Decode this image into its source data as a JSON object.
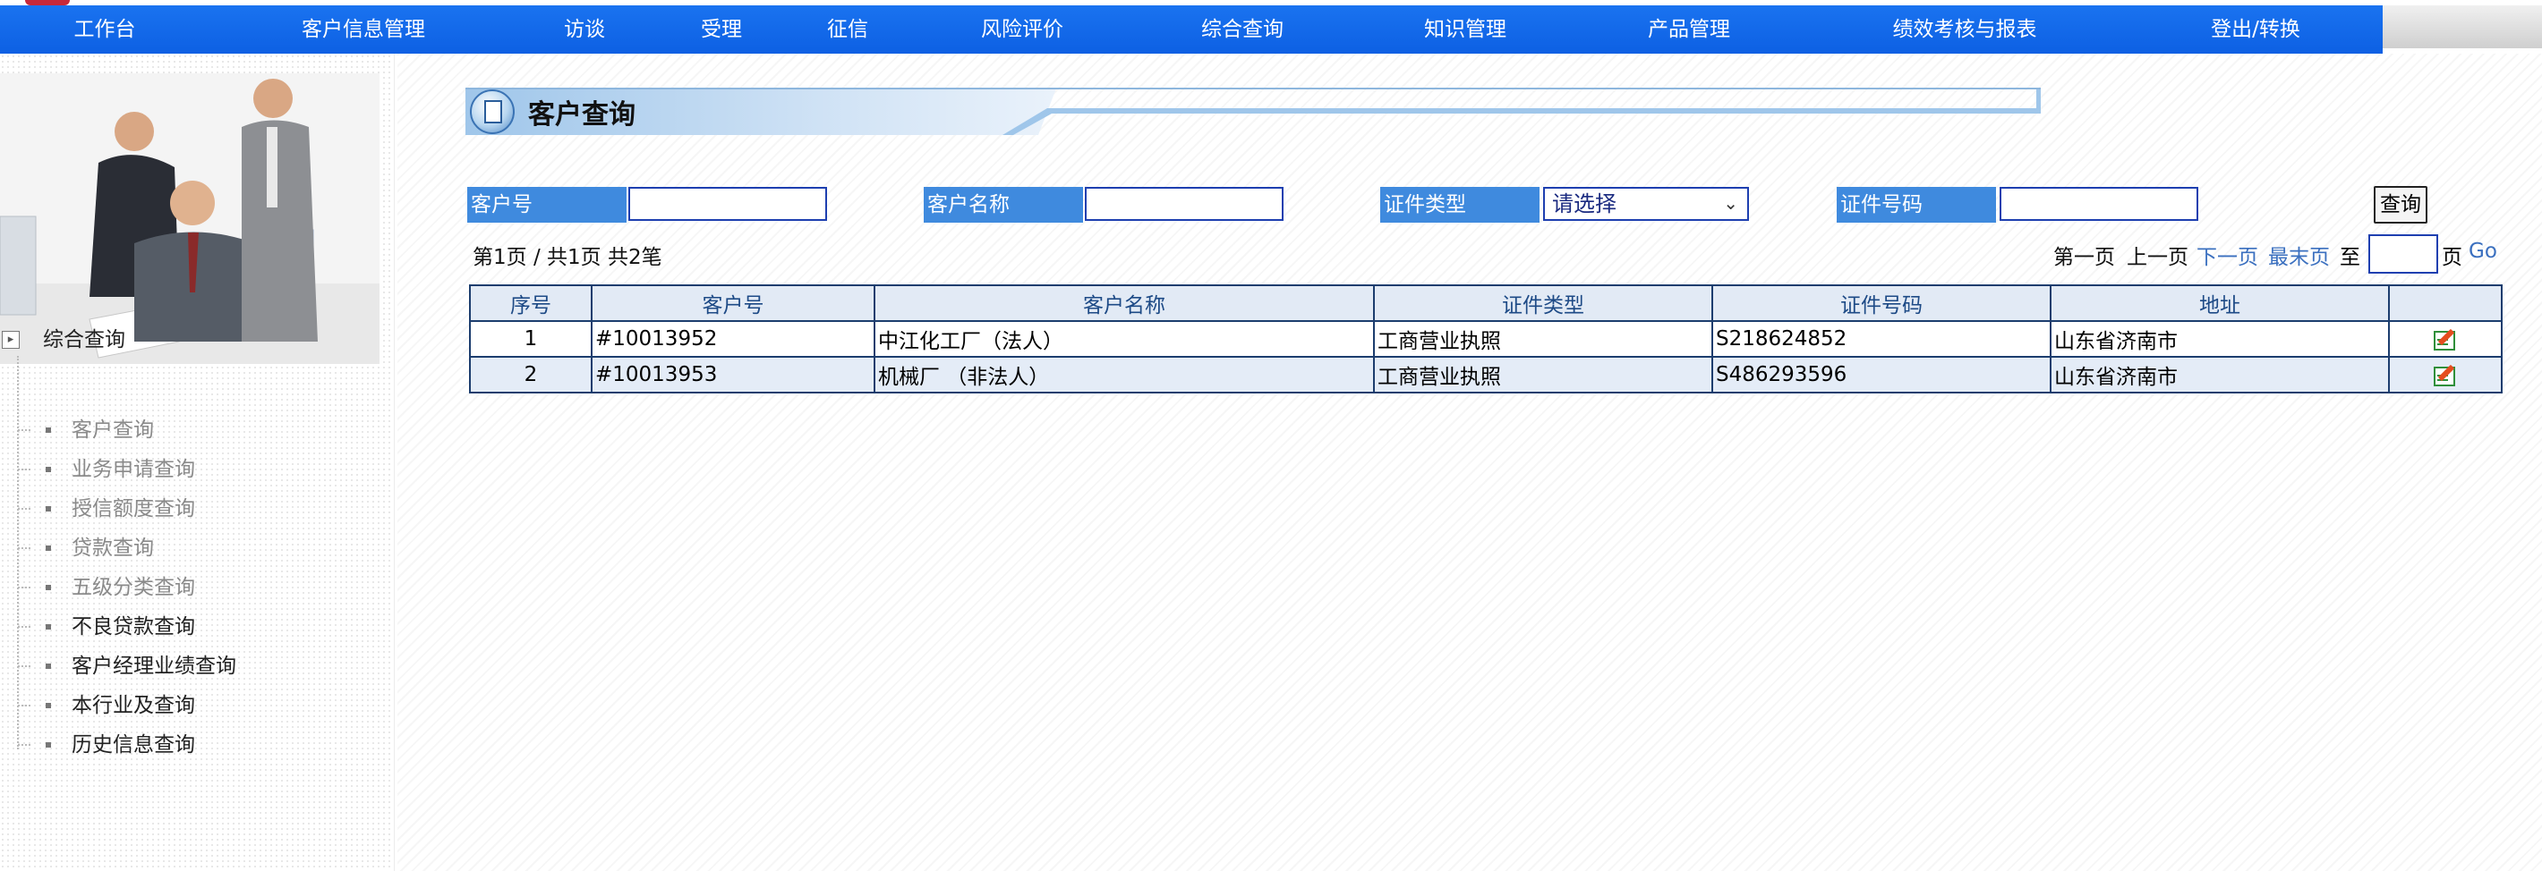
{
  "nav": {
    "items": [
      "工作台",
      "客户信息管理",
      "访谈",
      "受理",
      "征信",
      "风险评价",
      "综合查询",
      "知识管理",
      "产品管理",
      "绩效考核与报表",
      "登出/转换"
    ]
  },
  "sidebar": {
    "group_label": "综合查询",
    "items": [
      {
        "label": "客户查询"
      },
      {
        "label": "业务申请查询"
      },
      {
        "label": "授信额度查询"
      },
      {
        "label": "贷款查询"
      },
      {
        "label": "五级分类查询"
      },
      {
        "label": "不良贷款查询"
      },
      {
        "label": "客户经理业绩查询"
      },
      {
        "label": "本行业及查询"
      },
      {
        "label": "历史信息查询"
      }
    ]
  },
  "page": {
    "title": "客户查询"
  },
  "search": {
    "customer_no_label": "客户号",
    "customer_name_label": "客户名称",
    "cert_type_label": "证件类型",
    "cert_type_value": "请选择",
    "cert_no_label": "证件号码",
    "query_button": "查询"
  },
  "pagination": {
    "summary": "第1页 / 共1页  共2笔",
    "first": "第一页",
    "prev": "上一页",
    "next": "下一页",
    "last": "最末页",
    "to": "至",
    "page_suffix": "页",
    "go": "Go"
  },
  "table": {
    "headers": [
      "序号",
      "客户号",
      "客户名称",
      "证件类型",
      "证件号码",
      "地址",
      ""
    ],
    "rows": [
      [
        "1",
        "#10013952",
        "中江化工厂（法人）",
        "工商营业执照",
        "S218624852",
        "山东省济南市"
      ],
      [
        "2",
        "#10013953",
        "机械厂  （非法人）",
        "工商营业执照",
        "S486293596",
        "山东省济南市"
      ]
    ]
  },
  "colors": {
    "nav_blue": "#0d60e3",
    "label_blue": "#3f8ade",
    "link_blue": "#3a6fbf",
    "table_border": "#1c3d6e"
  }
}
